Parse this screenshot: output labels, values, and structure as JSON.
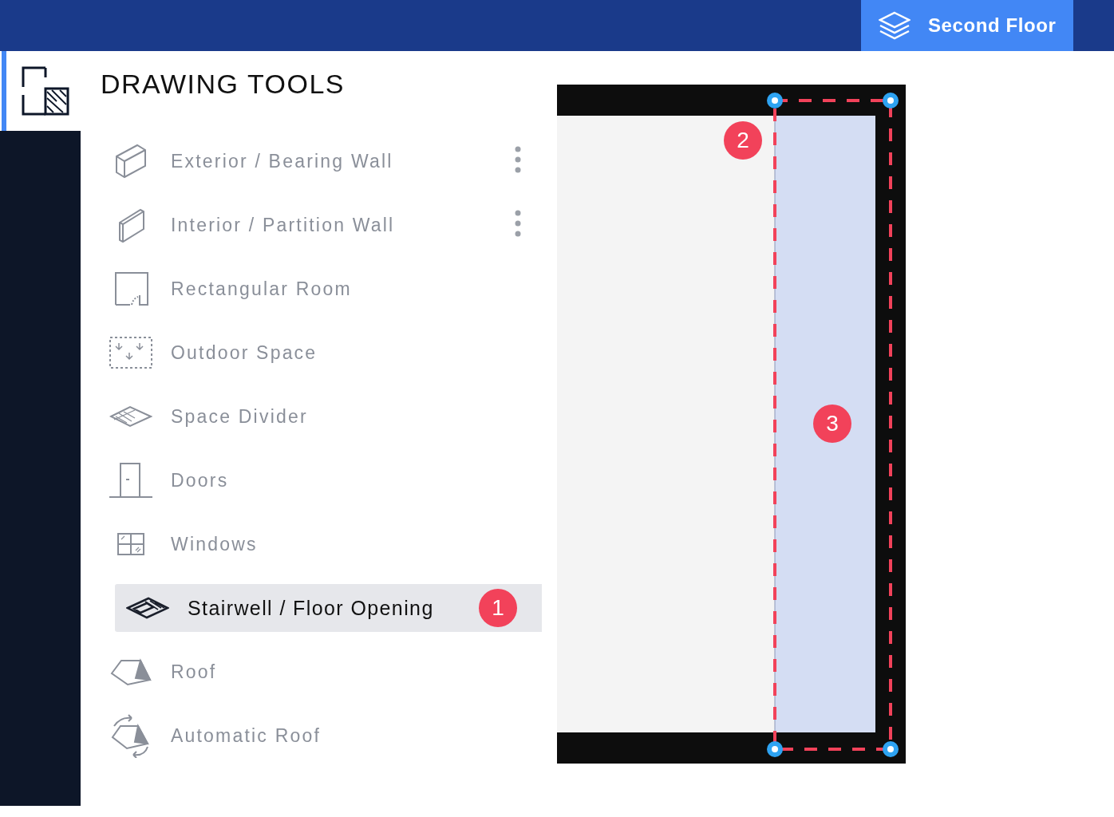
{
  "top_bar": {
    "floor_button": "Second Floor"
  },
  "panel": {
    "title": "DRAWING TOOLS"
  },
  "tools": [
    {
      "label": "Exterior / Bearing Wall",
      "kind": "exterior-wall",
      "selected": false,
      "menu": true
    },
    {
      "label": "Interior / Partition Wall",
      "kind": "interior-wall",
      "selected": false,
      "menu": true
    },
    {
      "label": "Rectangular Room",
      "kind": "room",
      "selected": false,
      "menu": false
    },
    {
      "label": "Outdoor Space",
      "kind": "outdoor",
      "selected": false,
      "menu": false
    },
    {
      "label": "Space Divider",
      "kind": "divider",
      "selected": false,
      "menu": false
    },
    {
      "label": "Doors",
      "kind": "door",
      "selected": false,
      "menu": false
    },
    {
      "label": "Windows",
      "kind": "window",
      "selected": false,
      "menu": false
    },
    {
      "label": "Stairwell / Floor Opening",
      "kind": "stairwell",
      "selected": true,
      "menu": false,
      "badge": "1"
    },
    {
      "label": "Roof",
      "kind": "roof",
      "selected": false,
      "menu": false
    },
    {
      "label": "Automatic Roof",
      "kind": "auto-roof",
      "selected": false,
      "menu": false
    }
  ],
  "canvas": {
    "markers": [
      {
        "label": "2"
      },
      {
        "label": "3"
      }
    ]
  }
}
